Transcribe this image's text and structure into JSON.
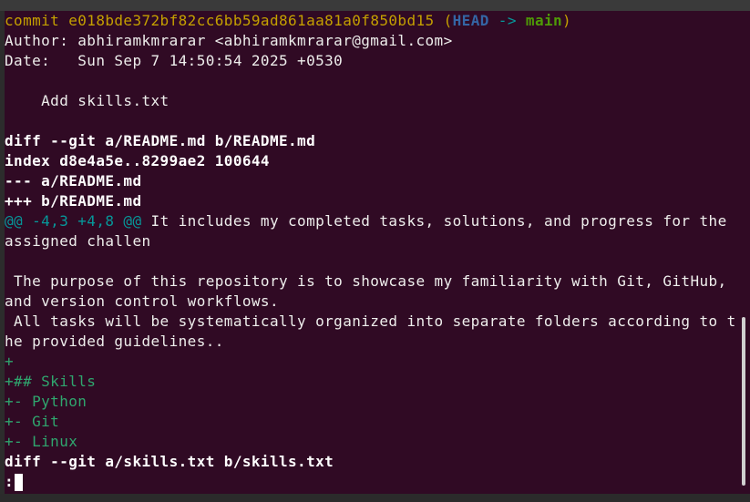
{
  "commit": {
    "prefix": "commit ",
    "hash": "e018bde372bf82cc6bb59ad861aa81a0f850bd15",
    "open": " (",
    "head": "HEAD",
    "arrow": " -> ",
    "branch": "main",
    "close": ")"
  },
  "author_line": "Author: abhiramkmrarar <abhiramkmrarar@gmail.com>",
  "date_line": "Date:   Sun Sep 7 14:50:54 2025 +0530",
  "message_line": "    Add skills.txt",
  "diff1": {
    "header": "diff --git a/README.md b/README.md",
    "index": "index d8e4a5e..8299ae2 100644",
    "minus_file": "--- a/README.md",
    "plus_file": "+++ b/README.md",
    "hunk_marker": "@@ -4,3 +4,8 @@",
    "hunk_context": " It includes my completed tasks, solutions, and progress for the",
    "hunk_context_wrap": "assigned challen",
    "context_lines": [
      " The purpose of this repository is to showcase my familiarity with Git, GitHub,",
      "and version control workflows.",
      " All tasks will be systematically organized into separate folders according to t",
      "he provided guidelines.."
    ],
    "added_lines": [
      "+",
      "+## Skills",
      "+- Python",
      "+- Git",
      "+- Linux"
    ]
  },
  "diff2": {
    "header": "diff --git a/skills.txt b/skills.txt"
  },
  "pager_prompt": ":",
  "colors": {
    "background": "#300a24",
    "commit": "#c4a000",
    "head": "#3465a4",
    "branch": "#4e9a06",
    "hunk": "#06989a",
    "added": "#2fa66e",
    "text": "#eeeeec"
  }
}
